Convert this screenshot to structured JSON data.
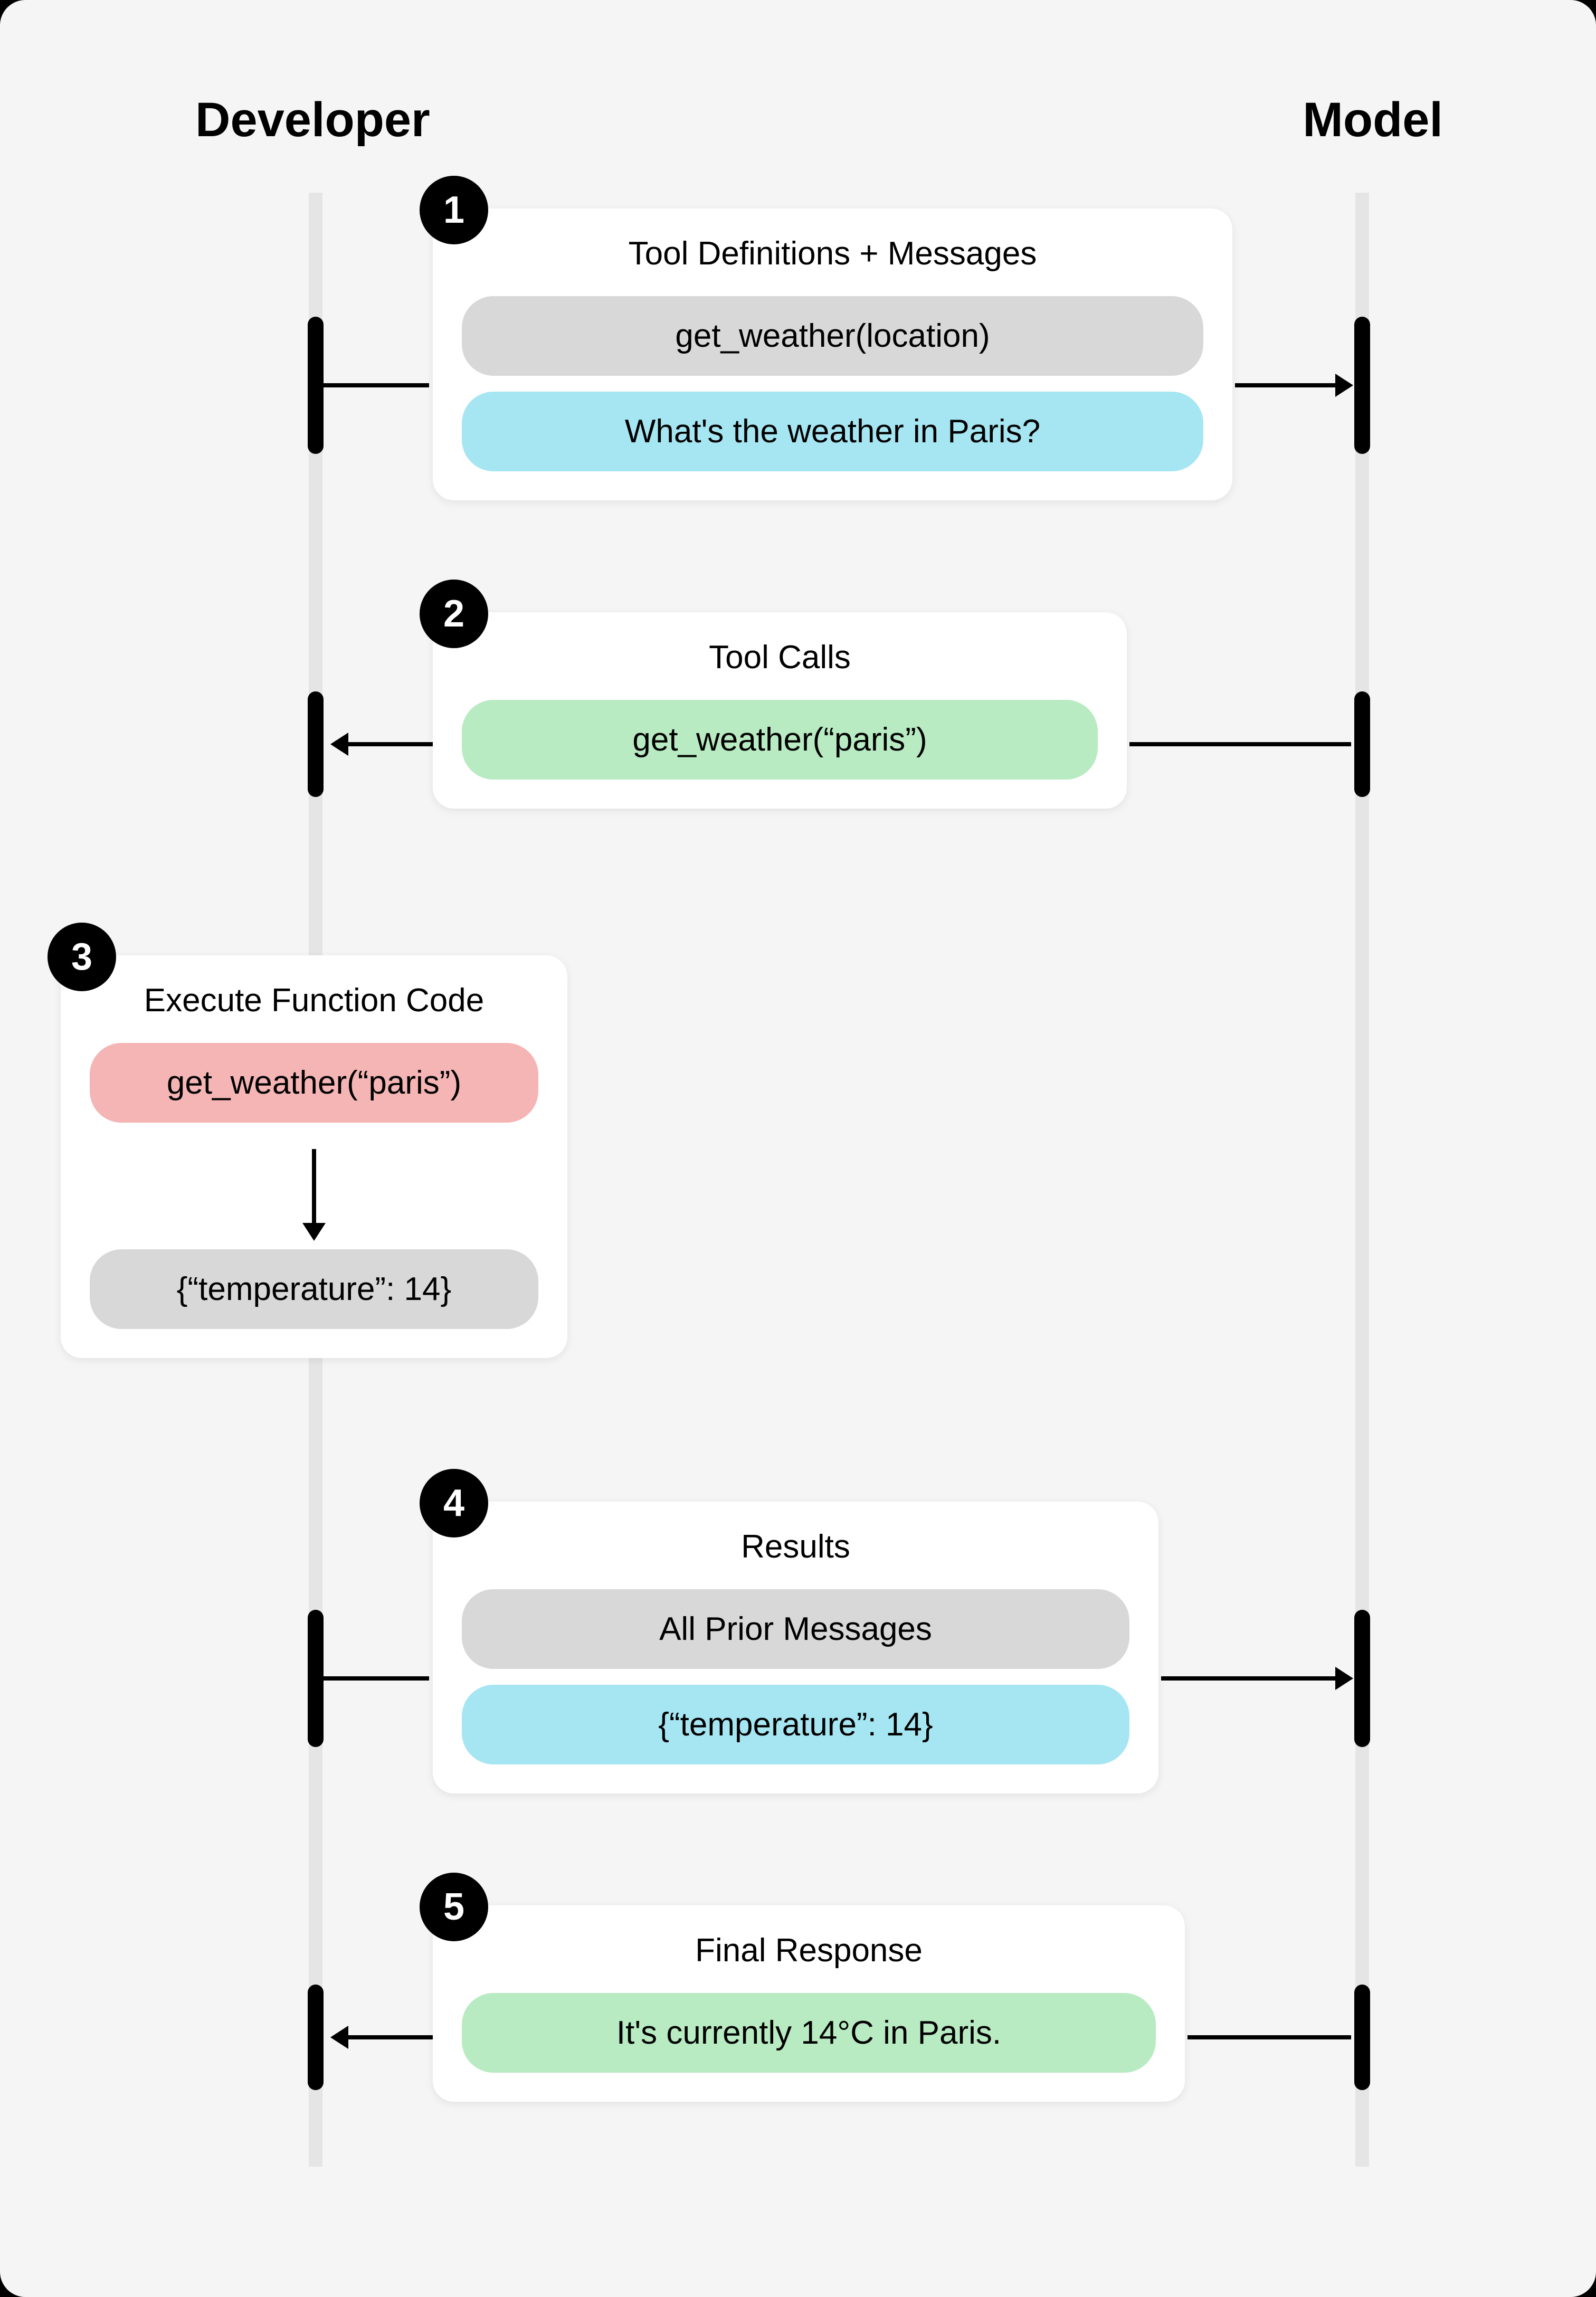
{
  "headers": {
    "developer": "Developer",
    "model": "Model"
  },
  "steps": {
    "step1": {
      "badge": "1",
      "title": "Tool Definitions + Messages",
      "definition": "get_weather(location)",
      "message": "What's the weather in Paris?"
    },
    "step2": {
      "badge": "2",
      "title": "Tool Calls",
      "call": "get_weather(“paris”)"
    },
    "step3": {
      "badge": "3",
      "title": "Execute Function Code",
      "call": "get_weather(“paris”)",
      "result": "{“temperature”: 14}"
    },
    "step4": {
      "badge": "4",
      "title": "Results",
      "prior": "All Prior Messages",
      "result": "{“temperature”: 14}"
    },
    "step5": {
      "badge": "5",
      "title": "Final Response",
      "response": "It's currently 14°C in Paris."
    }
  }
}
